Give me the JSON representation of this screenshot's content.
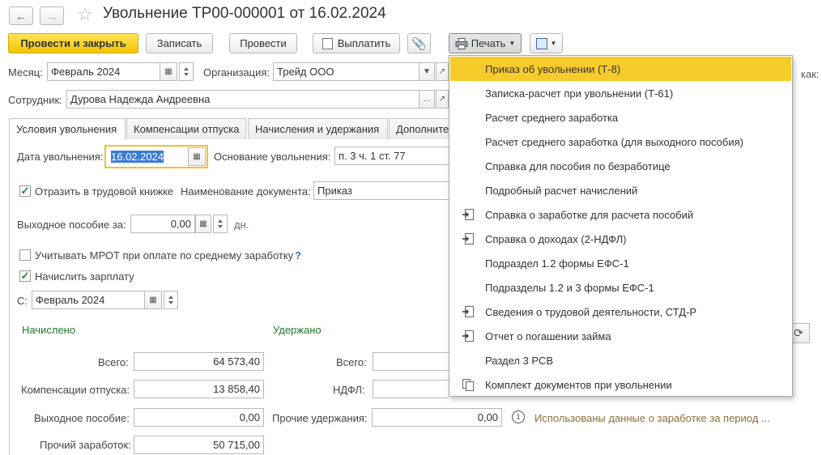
{
  "window": {
    "title": "Увольнение ТР00-000001 от 16.02.2024"
  },
  "toolbar": {
    "post_close": "Провести и закрыть",
    "write": "Записать",
    "post": "Провести",
    "pay": "Выплатить",
    "print": "Печать"
  },
  "header": {
    "month_label": "Месяц:",
    "month_value": "Февраль 2024",
    "org_label": "Организация:",
    "org_value": "Трейд ООО",
    "employee_label": "Сотрудник:",
    "employee_value": "Дурова Надежда Андреевна",
    "right_fragment": "как:"
  },
  "tabs": [
    "Условия увольнения",
    "Компенсации отпуска",
    "Начисления и удержания",
    "Дополните"
  ],
  "form": {
    "dismissal_date_label": "Дата увольнения:",
    "dismissal_date": "16.02.2024",
    "reason_label": "Основание увольнения:",
    "reason_value": "п. 3 ч. 1 ст. 77",
    "workbook_label": "Отразить в трудовой книжке",
    "doc_name_label": "Наименование документа:",
    "doc_name_value": "Приказ",
    "severance_label": "Выходное пособие за:",
    "severance_value": "0,00",
    "severance_unit": "дн.",
    "mrot_label": "Учитывать МРОТ при оплате по среднему заработку",
    "help": "?",
    "salary_label": "Начислить зарплату",
    "from_label": "С:",
    "from_value": "Февраль 2024",
    "accrued_title": "Начислено",
    "withheld_title": "Удержано",
    "total_label": "Всего:",
    "total_value": "64 573,40",
    "vacation_comp_label": "Компенсации отпуска:",
    "vacation_comp_value": "13 858,40",
    "severance2_label": "Выходное пособие:",
    "severance2_value": "0,00",
    "other_earn_label": "Прочий заработок:",
    "other_earn_value": "50 715,00",
    "w_total_label": "Всего:",
    "ndfl_label": "НДФЛ:",
    "other_withheld_label": "Прочие удержания:",
    "other_withheld_value": "0,00",
    "info_text": "Использованы данные о заработке за период ..."
  },
  "print_menu": [
    {
      "label": "Приказ об увольнении (Т-8)",
      "icon": "none",
      "highlighted": true
    },
    {
      "label": "Записка-расчет при увольнении (Т-61)",
      "icon": "none"
    },
    {
      "label": "Расчет среднего заработка",
      "icon": "none"
    },
    {
      "label": "Расчет среднего заработка (для выходного пособия)",
      "icon": "none"
    },
    {
      "label": "Справка для пособия по безработице",
      "icon": "none"
    },
    {
      "label": "Подробный расчет начислений",
      "icon": "none"
    },
    {
      "label": "Справка о заработке для расчета пособий",
      "icon": "document-arrow-icon"
    },
    {
      "label": "Справка о доходах (2-НДФЛ)",
      "icon": "document-arrow-icon"
    },
    {
      "label": "Подраздел 1.2 формы ЕФС-1",
      "icon": "none"
    },
    {
      "label": "Подразделы 1.2 и 3 формы ЕФС-1",
      "icon": "none"
    },
    {
      "label": "Сведения о трудовой деятельности, СТД-Р",
      "icon": "document-arrow-icon"
    },
    {
      "label": "Отчет о погашении займа",
      "icon": "document-arrow-icon"
    },
    {
      "label": "Раздел 3 РСВ",
      "icon": "none"
    },
    {
      "label": "Комплект документов при увольнении",
      "icon": "documents-set-icon"
    }
  ]
}
